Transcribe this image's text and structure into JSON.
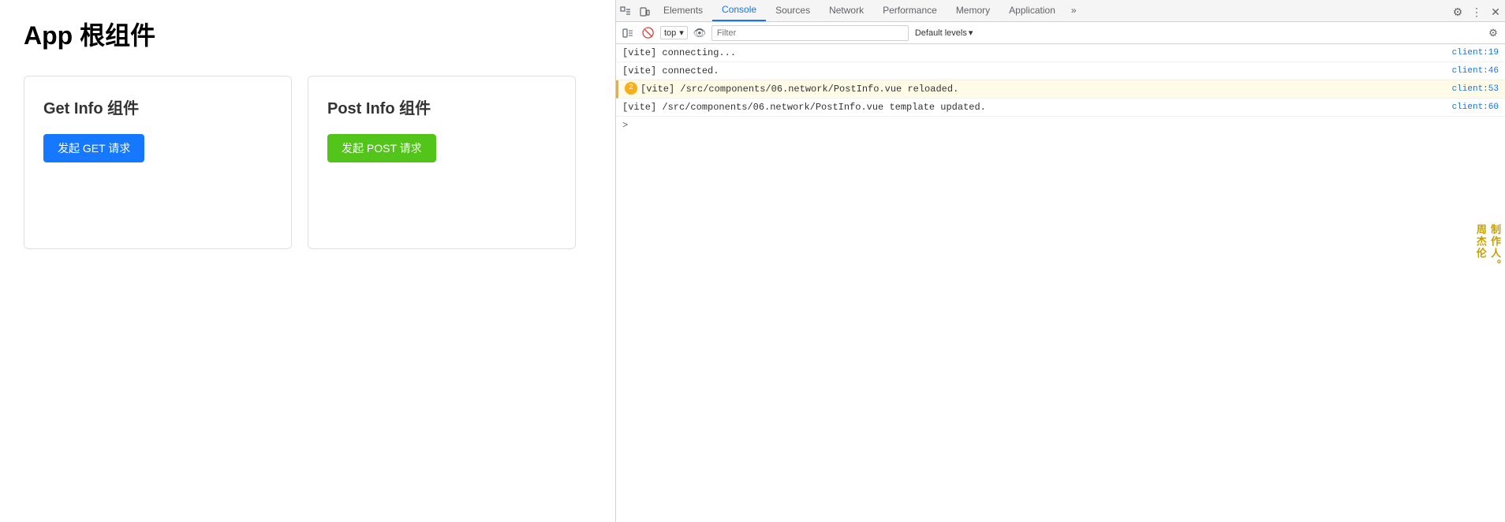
{
  "app": {
    "title": "App 根组件",
    "components": [
      {
        "title": "Get Info 组件",
        "button_label": "发起 GET 请求",
        "button_type": "get"
      },
      {
        "title": "Post Info 组件",
        "button_label": "发起 POST 请求",
        "button_type": "post"
      }
    ]
  },
  "devtools": {
    "tabs": [
      {
        "label": "Elements",
        "active": false
      },
      {
        "label": "Console",
        "active": true
      },
      {
        "label": "Sources",
        "active": false
      },
      {
        "label": "Network",
        "active": false
      },
      {
        "label": "Performance",
        "active": false
      },
      {
        "label": "Memory",
        "active": false
      },
      {
        "label": "Application",
        "active": false
      },
      {
        "label": "»",
        "active": false
      }
    ],
    "console": {
      "context_label": "top",
      "filter_placeholder": "Filter",
      "levels_label": "Default levels",
      "messages": [
        {
          "text": "[vite] connecting...",
          "source": "client:19",
          "type": "normal",
          "badge": null
        },
        {
          "text": "[vite] connected.",
          "source": "client:46",
          "type": "normal",
          "badge": null
        },
        {
          "text": "[vite] /src/components/06.network/PostInfo.vue reloaded.",
          "source": "client:53",
          "type": "warning",
          "badge": "2"
        },
        {
          "text": "[vite] /src/components/06.network/PostInfo.vue template updated.",
          "source": "client:60",
          "type": "normal",
          "badge": null
        }
      ],
      "prompt_caret": ">"
    }
  },
  "watermark": {
    "line1": "制作人。",
    "line2": "周杰伦"
  }
}
